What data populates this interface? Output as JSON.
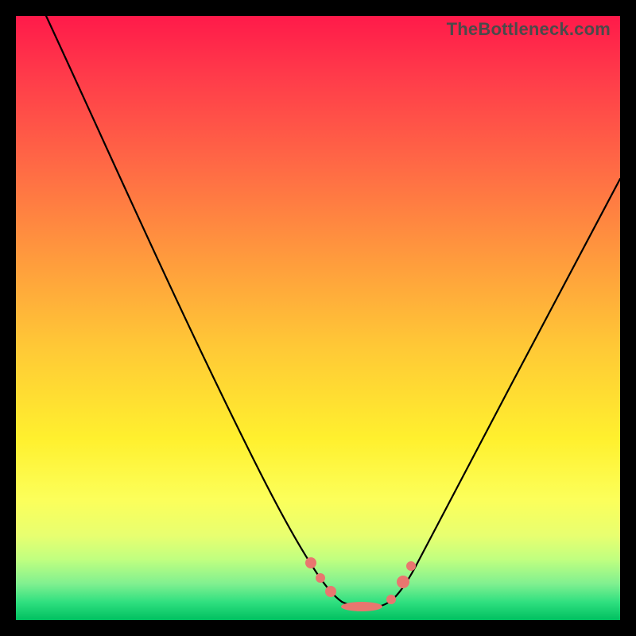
{
  "watermark": "TheBottleneck.com",
  "chart_data": {
    "type": "line",
    "title": "",
    "xlabel": "",
    "ylabel": "",
    "xlim": [
      0,
      100
    ],
    "ylim": [
      0,
      100
    ],
    "grid": false,
    "legend": false,
    "background": "heatmap-gradient-red-to-green",
    "series": [
      {
        "name": "bottleneck-curve",
        "x": [
          5,
          10,
          15,
          20,
          25,
          30,
          35,
          40,
          45,
          48,
          50,
          52,
          54,
          56,
          58,
          60,
          62,
          65,
          70,
          75,
          80,
          85,
          90,
          95,
          100
        ],
        "y": [
          100,
          90,
          80,
          70,
          60,
          50,
          40,
          30,
          18,
          10,
          5,
          2,
          1,
          1,
          1,
          2,
          5,
          10,
          20,
          30,
          38,
          46,
          53,
          59,
          64
        ]
      }
    ],
    "markers": [
      {
        "x": 48,
        "y": 10
      },
      {
        "x": 50,
        "y": 5
      },
      {
        "x": 52,
        "y": 2
      },
      {
        "x": 56,
        "y": 1
      },
      {
        "x": 60,
        "y": 2
      },
      {
        "x": 62,
        "y": 6
      },
      {
        "x": 63,
        "y": 10
      }
    ]
  }
}
